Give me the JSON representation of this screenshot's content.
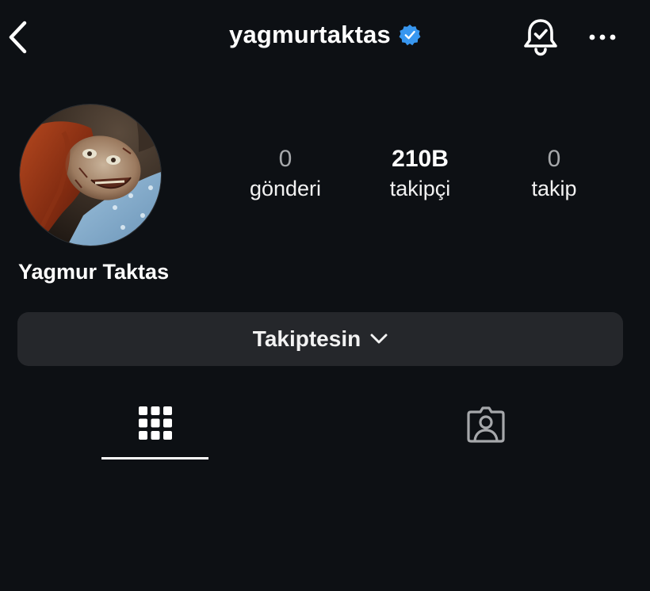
{
  "header": {
    "username": "yagmurtaktas"
  },
  "profile": {
    "full_name": "Yagmur Taktas",
    "stats": {
      "posts": {
        "value": "0",
        "label": "gönderi"
      },
      "followers": {
        "value": "210B",
        "label": "takipçi"
      },
      "following": {
        "value": "0",
        "label": "takip"
      }
    }
  },
  "actions": {
    "follow_label": "Takiptesin"
  },
  "colors": {
    "background": "#0d1014",
    "verified_badge": "#3897f0",
    "button_bg": "#25272b"
  },
  "icons": {
    "back": "chevron-left-icon",
    "verified": "verified-badge-icon",
    "notifications": "bell-check-icon",
    "more": "more-horizontal-icon",
    "grid": "grid-icon",
    "tagged": "tagged-user-icon"
  }
}
